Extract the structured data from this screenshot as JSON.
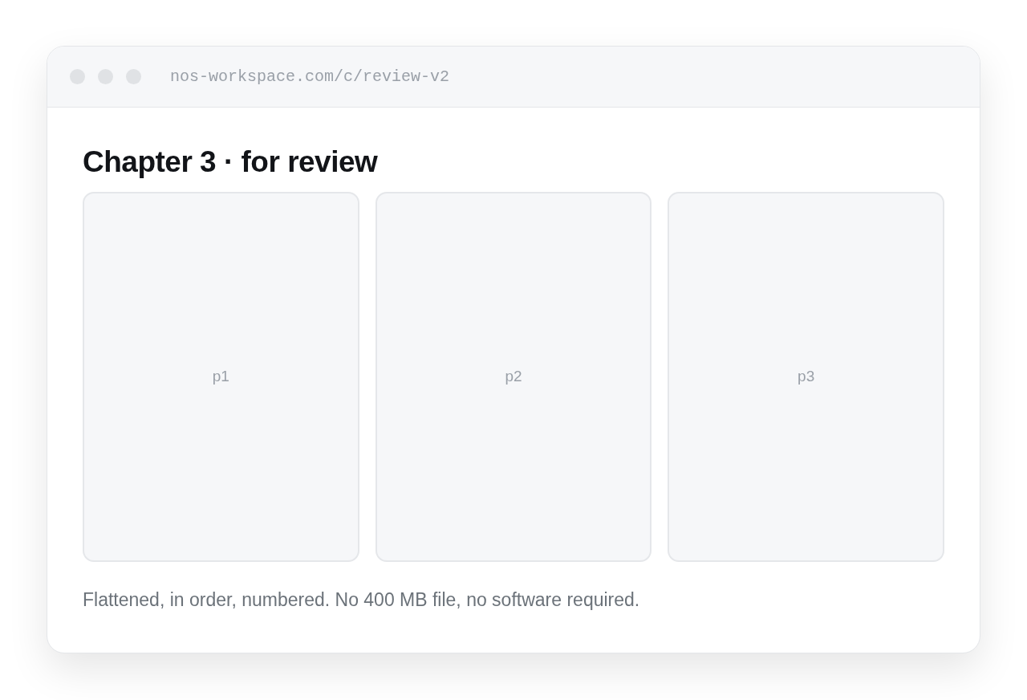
{
  "window": {
    "address": "nos-workspace.com/c/review-v2"
  },
  "heading": "Chapter 3 · for review",
  "pages": [
    {
      "label": "p1"
    },
    {
      "label": "p2"
    },
    {
      "label": "p3"
    }
  ],
  "caption": "Flattened, in order, numbered. No 400 MB file, no software required."
}
